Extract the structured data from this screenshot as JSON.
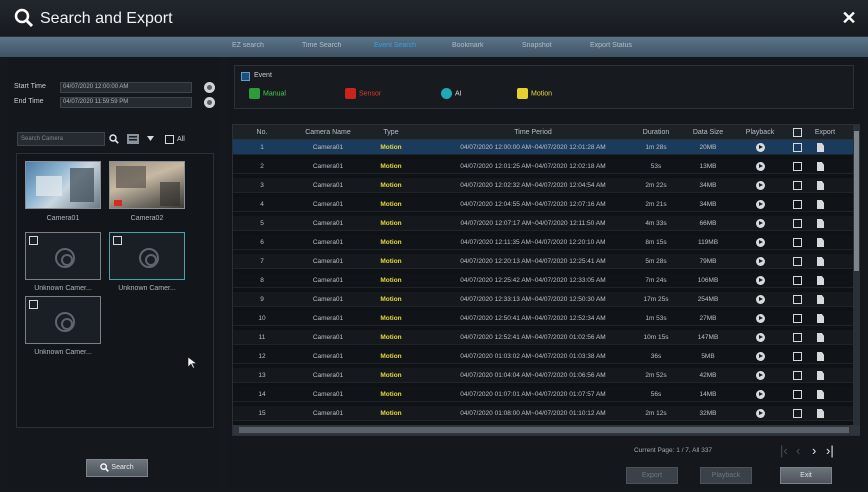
{
  "window": {
    "title": "Search and Export"
  },
  "tabs": [
    {
      "label": "EZ search",
      "active": false
    },
    {
      "label": "Time Search",
      "active": false
    },
    {
      "label": "Event Search",
      "active": true
    },
    {
      "label": "Bookmark",
      "active": false
    },
    {
      "label": "Snapshot",
      "active": false
    },
    {
      "label": "Export Status",
      "active": false
    }
  ],
  "left": {
    "start_label": "Start Time",
    "start_value": "04/07/2020 12:00:00 AM",
    "end_label": "End Time",
    "end_value": "04/07/2020 11:59:59 PM",
    "search_placeholder": "Search Camera",
    "all_label": "All",
    "cameras": [
      {
        "label": "Camera01"
      },
      {
        "label": "Camera02"
      },
      {
        "label": "Unknown Camer..."
      },
      {
        "label": "Unknown Camer..."
      },
      {
        "label": "Unknown Camer..."
      }
    ],
    "search_button": "Search"
  },
  "events": {
    "header": "Event",
    "items": [
      {
        "label": "Manual",
        "color": "#2f9a3a",
        "text_color": "#46d04f"
      },
      {
        "label": "Sensor",
        "color": "#c8241e",
        "text_color": "#e0362f"
      },
      {
        "label": "AI",
        "color": "#21a9b5",
        "text_color": "#d6dadd"
      },
      {
        "label": "Motion",
        "color": "#e5d12e",
        "text_color": "#e9d93c"
      }
    ]
  },
  "table": {
    "headers": {
      "no": "No.",
      "camera": "Camera Name",
      "type": "Type",
      "period": "Time Period",
      "duration": "Duration",
      "size": "Data Size",
      "playback": "Playback",
      "export": "Export"
    },
    "rows": [
      {
        "no": "1",
        "camera": "Camera01",
        "type": "Motion",
        "period": "04/07/2020 12:00:00 AM~04/07/2020 12:01:28 AM",
        "duration": "1m 28s",
        "size": "20MB"
      },
      {
        "no": "2",
        "camera": "Camera01",
        "type": "Motion",
        "period": "04/07/2020 12:01:25 AM~04/07/2020 12:02:18 AM",
        "duration": "53s",
        "size": "13MB"
      },
      {
        "no": "3",
        "camera": "Camera01",
        "type": "Motion",
        "period": "04/07/2020 12:02:32 AM~04/07/2020 12:04:54 AM",
        "duration": "2m 22s",
        "size": "34MB"
      },
      {
        "no": "4",
        "camera": "Camera01",
        "type": "Motion",
        "period": "04/07/2020 12:04:55 AM~04/07/2020 12:07:16 AM",
        "duration": "2m 21s",
        "size": "34MB"
      },
      {
        "no": "5",
        "camera": "Camera01",
        "type": "Motion",
        "period": "04/07/2020 12:07:17 AM~04/07/2020 12:11:50 AM",
        "duration": "4m 33s",
        "size": "66MB"
      },
      {
        "no": "6",
        "camera": "Camera01",
        "type": "Motion",
        "period": "04/07/2020 12:11:35 AM~04/07/2020 12:20:10 AM",
        "duration": "8m 15s",
        "size": "119MB"
      },
      {
        "no": "7",
        "camera": "Camera01",
        "type": "Motion",
        "period": "04/07/2020 12:20:13 AM~04/07/2020 12:25:41 AM",
        "duration": "5m 28s",
        "size": "79MB"
      },
      {
        "no": "8",
        "camera": "Camera01",
        "type": "Motion",
        "period": "04/07/2020 12:25:42 AM~04/07/2020 12:33:05 AM",
        "duration": "7m 24s",
        "size": "106MB"
      },
      {
        "no": "9",
        "camera": "Camera01",
        "type": "Motion",
        "period": "04/07/2020 12:33:13 AM~04/07/2020 12:50:30 AM",
        "duration": "17m 25s",
        "size": "254MB"
      },
      {
        "no": "10",
        "camera": "Camera01",
        "type": "Motion",
        "period": "04/07/2020 12:50:41 AM~04/07/2020 12:52:34 AM",
        "duration": "1m 53s",
        "size": "27MB"
      },
      {
        "no": "11",
        "camera": "Camera01",
        "type": "Motion",
        "period": "04/07/2020 12:52:41 AM~04/07/2020 01:02:56 AM",
        "duration": "10m 15s",
        "size": "147MB"
      },
      {
        "no": "12",
        "camera": "Camera01",
        "type": "Motion",
        "period": "04/07/2020 01:03:02 AM~04/07/2020 01:03:38 AM",
        "duration": "36s",
        "size": "5MB"
      },
      {
        "no": "13",
        "camera": "Camera01",
        "type": "Motion",
        "period": "04/07/2020 01:04:04 AM~04/07/2020 01:06:56 AM",
        "duration": "2m 52s",
        "size": "42MB"
      },
      {
        "no": "14",
        "camera": "Camera01",
        "type": "Motion",
        "period": "04/07/2020 01:07:01 AM~04/07/2020 01:07:57 AM",
        "duration": "56s",
        "size": "14MB"
      },
      {
        "no": "15",
        "camera": "Camera01",
        "type": "Motion",
        "period": "04/07/2020 01:08:00 AM~04/07/2020 01:10:12 AM",
        "duration": "2m 12s",
        "size": "32MB"
      }
    ]
  },
  "pager": {
    "text": "Current Page: 1 / 7, All 337"
  },
  "buttons": {
    "export": "Export",
    "playback": "Playback",
    "exit": "Exit"
  }
}
